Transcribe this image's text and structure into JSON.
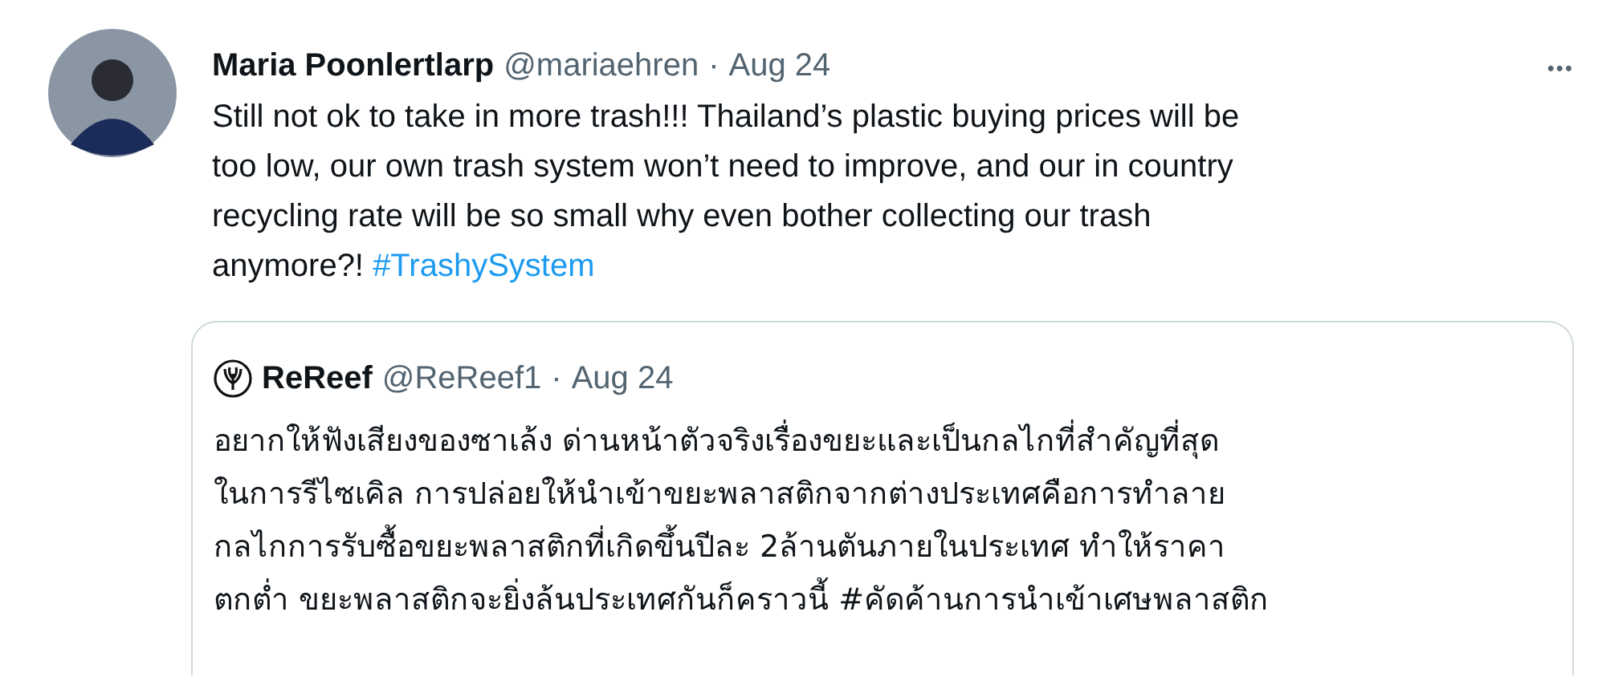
{
  "tweet": {
    "author": "Maria Poonlertlarp",
    "handle": "@mariaehren",
    "separator": "·",
    "date": "Aug 24",
    "more": "•••",
    "text_lines": [
      "Still not ok to take in more trash!!! Thailand’s plastic buying prices will be",
      "too low, our own trash system won’t need to improve, and our in country",
      "recycling rate will be so small why even bother collecting our trash",
      "anymore?!"
    ],
    "hashtag": "#TrashySystem",
    "quoted_tweet": {
      "author": "ReReef",
      "handle": "@ReReef1",
      "separator": "·",
      "date": "Aug 24",
      "text_lines": [
        "อยากให้ฟังเสียงของซาเล้ง ด่านหน้าตัวจริงเรื่องขยะและเป็นกลไกที่สำคัญที่สุด",
        "ในการรีไซเคิล การปล่อยให้นำเข้าขยะพลาสติกจากต่างประเทศคือการทำลาย",
        "กลไกการรับซื้อขยะพลาสติกที่เกิดขึ้นปีละ 2ล้านตันภายในประเทศ ทำให้ราคา",
        "ตกต่ำ ขยะพลาสติกจะยิ่งล้นประเทศกันก็คราวนี้ #คัดค้านการนำเข้าเศษพลาสติก"
      ]
    }
  }
}
